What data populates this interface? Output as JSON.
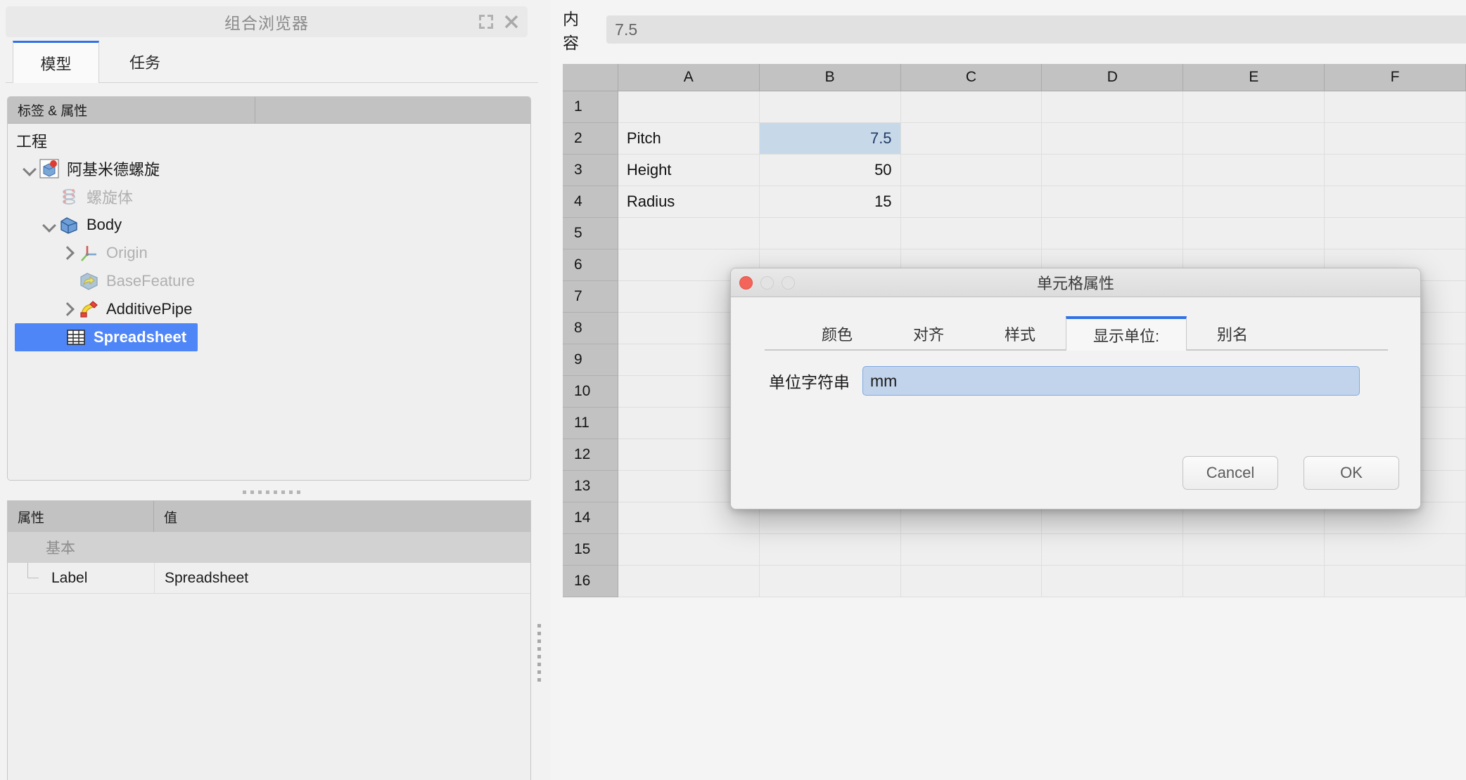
{
  "left_panel": {
    "title": "组合浏览器",
    "titlebar_icons": [
      "float-icon",
      "close-icon"
    ],
    "tabs": [
      {
        "label": "模型",
        "active": true
      },
      {
        "label": "任务",
        "active": false
      }
    ],
    "tree_header": {
      "col_label": "标签 & 属性",
      "col_prop": ""
    },
    "tree": [
      {
        "label": "工程",
        "depth": 0,
        "twist": "none",
        "icon": "none",
        "state": "normal"
      },
      {
        "label": "阿基米德螺旋",
        "depth": 1,
        "twist": "down",
        "icon": "document-icon",
        "state": "normal"
      },
      {
        "label": "螺旋体",
        "depth": 2,
        "twist": "none",
        "icon": "helix-icon",
        "state": "dim"
      },
      {
        "label": "Body",
        "depth": 2,
        "twist": "down",
        "icon": "body-icon",
        "state": "normal"
      },
      {
        "label": "Origin",
        "depth": 3,
        "twist": "right",
        "icon": "origin-axis-icon",
        "state": "dim"
      },
      {
        "label": "BaseFeature",
        "depth": 3,
        "twist": "none",
        "icon": "basefeature-icon",
        "state": "dim"
      },
      {
        "label": "AdditivePipe",
        "depth": 3,
        "twist": "right",
        "icon": "additivepipe-icon",
        "state": "normal"
      },
      {
        "label": "Spreadsheet",
        "depth": 2,
        "twist": "none",
        "icon": "spreadsheet-icon",
        "state": "selected"
      }
    ],
    "property_header": {
      "name": "属性",
      "value": "值"
    },
    "property_rows": [
      {
        "type": "group",
        "name": "基本",
        "value": ""
      },
      {
        "type": "item",
        "name": "Label",
        "value": "Spreadsheet"
      }
    ]
  },
  "sheet": {
    "content_label": "内容",
    "content_value": "7.5",
    "content_placeholder": "",
    "columns": [
      "A",
      "B",
      "C",
      "D",
      "E",
      "F"
    ],
    "rows": [
      "1",
      "2",
      "3",
      "4",
      "5",
      "6",
      "7",
      "8",
      "9",
      "10",
      "11",
      "12",
      "13",
      "14",
      "15",
      "16"
    ],
    "cells": [
      {
        "row": "2",
        "col": "A",
        "value": "Pitch",
        "align": "left",
        "selected": false
      },
      {
        "row": "2",
        "col": "B",
        "value": "7.5",
        "align": "right",
        "selected": true
      },
      {
        "row": "3",
        "col": "A",
        "value": "Height",
        "align": "left",
        "selected": false
      },
      {
        "row": "3",
        "col": "B",
        "value": "50",
        "align": "right",
        "selected": false
      },
      {
        "row": "4",
        "col": "A",
        "value": "Radius",
        "align": "left",
        "selected": false
      },
      {
        "row": "4",
        "col": "B",
        "value": "15",
        "align": "right",
        "selected": false
      }
    ],
    "selected_cell_bg": "#c7d9e9",
    "selected_cell_fg": "#1f3a66"
  },
  "dialog": {
    "title": "单元格属性",
    "traffic_lights": [
      "close-button",
      "minimize-button",
      "zoom-button"
    ],
    "tabs": [
      {
        "label": "颜色",
        "active": false
      },
      {
        "label": "对齐",
        "active": false
      },
      {
        "label": "样式",
        "active": false
      },
      {
        "label": "显示单位:",
        "active": true
      },
      {
        "label": "别名",
        "active": false
      }
    ],
    "unit_label": "单位字符串",
    "unit_value": "mm",
    "unit_placeholder": "",
    "buttons": {
      "cancel": "Cancel",
      "ok": "OK"
    },
    "accent_color": "#2f71e8"
  }
}
